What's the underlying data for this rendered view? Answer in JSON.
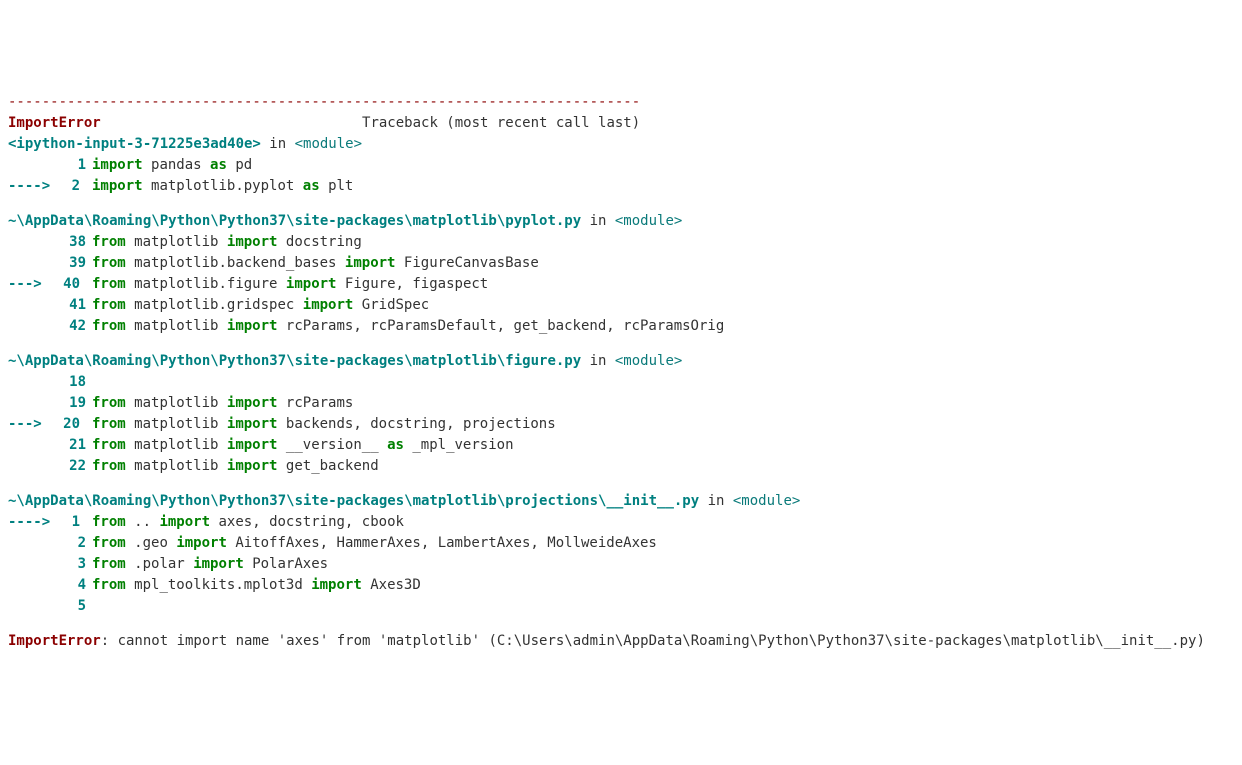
{
  "separator": "---------------------------------------------------------------------------",
  "error_name": "ImportError",
  "traceback_text": "Traceback (most recent call last)",
  "frames": [
    {
      "location_prefix": "<ipython-input-3-71225e3ad40e>",
      "location_suffix": " in ",
      "module_tag": "<module>",
      "lines": [
        {
          "arrow": "",
          "num": "1",
          "tokens": [
            [
              "kw",
              "import"
            ],
            [
              "sp",
              " "
            ],
            [
              "id",
              "pandas"
            ],
            [
              "sp",
              " "
            ],
            [
              "kw",
              "as"
            ],
            [
              "sp",
              " "
            ],
            [
              "id",
              "pd"
            ]
          ]
        },
        {
          "arrow": "----> ",
          "num": "2",
          "tokens": [
            [
              "kw",
              "import"
            ],
            [
              "sp",
              " "
            ],
            [
              "id",
              "matplotlib"
            ],
            [
              "punct",
              "."
            ],
            [
              "id",
              "pyplot"
            ],
            [
              "sp",
              " "
            ],
            [
              "kw",
              "as"
            ],
            [
              "sp",
              " "
            ],
            [
              "id",
              "plt"
            ]
          ]
        }
      ]
    },
    {
      "location_prefix": "~\\AppData\\Roaming\\Python\\Python37\\site-packages\\matplotlib\\pyplot.py",
      "location_suffix": " in ",
      "module_tag": "<module>",
      "lines": [
        {
          "arrow": "",
          "num": "38",
          "tokens": [
            [
              "kw",
              "from"
            ],
            [
              "sp",
              " "
            ],
            [
              "id",
              "matplotlib"
            ],
            [
              "sp",
              " "
            ],
            [
              "kw",
              "import"
            ],
            [
              "sp",
              " "
            ],
            [
              "id",
              "docstring"
            ]
          ]
        },
        {
          "arrow": "",
          "num": "39",
          "tokens": [
            [
              "kw",
              "from"
            ],
            [
              "sp",
              " "
            ],
            [
              "id",
              "matplotlib"
            ],
            [
              "punct",
              "."
            ],
            [
              "id",
              "backend_bases"
            ],
            [
              "sp",
              " "
            ],
            [
              "kw",
              "import"
            ],
            [
              "sp",
              " "
            ],
            [
              "id",
              "FigureCanvasBase"
            ]
          ]
        },
        {
          "arrow": "---> ",
          "num": "40",
          "tokens": [
            [
              "kw",
              "from"
            ],
            [
              "sp",
              " "
            ],
            [
              "id",
              "matplotlib"
            ],
            [
              "punct",
              "."
            ],
            [
              "id",
              "figure"
            ],
            [
              "sp",
              " "
            ],
            [
              "kw",
              "import"
            ],
            [
              "sp",
              " "
            ],
            [
              "id",
              "Figure"
            ],
            [
              "punct",
              ","
            ],
            [
              "sp",
              " "
            ],
            [
              "id",
              "figaspect"
            ]
          ]
        },
        {
          "arrow": "",
          "num": "41",
          "tokens": [
            [
              "kw",
              "from"
            ],
            [
              "sp",
              " "
            ],
            [
              "id",
              "matplotlib"
            ],
            [
              "punct",
              "."
            ],
            [
              "id",
              "gridspec"
            ],
            [
              "sp",
              " "
            ],
            [
              "kw",
              "import"
            ],
            [
              "sp",
              " "
            ],
            [
              "id",
              "GridSpec"
            ]
          ]
        },
        {
          "arrow": "",
          "num": "42",
          "tokens": [
            [
              "kw",
              "from"
            ],
            [
              "sp",
              " "
            ],
            [
              "id",
              "matplotlib"
            ],
            [
              "sp",
              " "
            ],
            [
              "kw",
              "import"
            ],
            [
              "sp",
              " "
            ],
            [
              "id",
              "rcParams"
            ],
            [
              "punct",
              ","
            ],
            [
              "sp",
              " "
            ],
            [
              "id",
              "rcParamsDefault"
            ],
            [
              "punct",
              ","
            ],
            [
              "sp",
              " "
            ],
            [
              "id",
              "get_backend"
            ],
            [
              "punct",
              ","
            ],
            [
              "sp",
              " "
            ],
            [
              "id",
              "rcParamsOrig"
            ]
          ]
        }
      ]
    },
    {
      "location_prefix": "~\\AppData\\Roaming\\Python\\Python37\\site-packages\\matplotlib\\figure.py",
      "location_suffix": " in ",
      "module_tag": "<module>",
      "lines": [
        {
          "arrow": "",
          "num": "18",
          "tokens": []
        },
        {
          "arrow": "",
          "num": "19",
          "tokens": [
            [
              "kw",
              "from"
            ],
            [
              "sp",
              " "
            ],
            [
              "id",
              "matplotlib"
            ],
            [
              "sp",
              " "
            ],
            [
              "kw",
              "import"
            ],
            [
              "sp",
              " "
            ],
            [
              "id",
              "rcParams"
            ]
          ]
        },
        {
          "arrow": "---> ",
          "num": "20",
          "tokens": [
            [
              "kw",
              "from"
            ],
            [
              "sp",
              " "
            ],
            [
              "id",
              "matplotlib"
            ],
            [
              "sp",
              " "
            ],
            [
              "kw",
              "import"
            ],
            [
              "sp",
              " "
            ],
            [
              "id",
              "backends"
            ],
            [
              "punct",
              ","
            ],
            [
              "sp",
              " "
            ],
            [
              "id",
              "docstring"
            ],
            [
              "punct",
              ","
            ],
            [
              "sp",
              " "
            ],
            [
              "id",
              "projections"
            ]
          ]
        },
        {
          "arrow": "",
          "num": "21",
          "tokens": [
            [
              "kw",
              "from"
            ],
            [
              "sp",
              " "
            ],
            [
              "id",
              "matplotlib"
            ],
            [
              "sp",
              " "
            ],
            [
              "kw",
              "import"
            ],
            [
              "sp",
              " "
            ],
            [
              "id",
              "__version__"
            ],
            [
              "sp",
              " "
            ],
            [
              "kw",
              "as"
            ],
            [
              "sp",
              " "
            ],
            [
              "id",
              "_mpl_version"
            ]
          ]
        },
        {
          "arrow": "",
          "num": "22",
          "tokens": [
            [
              "kw",
              "from"
            ],
            [
              "sp",
              " "
            ],
            [
              "id",
              "matplotlib"
            ],
            [
              "sp",
              " "
            ],
            [
              "kw",
              "import"
            ],
            [
              "sp",
              " "
            ],
            [
              "id",
              "get_backend"
            ]
          ]
        }
      ]
    },
    {
      "location_prefix": "~\\AppData\\Roaming\\Python\\Python37\\site-packages\\matplotlib\\projections\\__init__.py",
      "location_suffix": " in ",
      "module_tag": "<module>",
      "lines": [
        {
          "arrow": "----> ",
          "num": "1",
          "tokens": [
            [
              "kw",
              "from"
            ],
            [
              "sp",
              " "
            ],
            [
              "punct",
              ".."
            ],
            [
              "sp",
              " "
            ],
            [
              "kw",
              "import"
            ],
            [
              "sp",
              " "
            ],
            [
              "id",
              "axes"
            ],
            [
              "punct",
              ","
            ],
            [
              "sp",
              " "
            ],
            [
              "id",
              "docstring"
            ],
            [
              "punct",
              ","
            ],
            [
              "sp",
              " "
            ],
            [
              "id",
              "cbook"
            ]
          ]
        },
        {
          "arrow": "",
          "num": "2",
          "tokens": [
            [
              "kw",
              "from"
            ],
            [
              "sp",
              " "
            ],
            [
              "punct",
              "."
            ],
            [
              "id",
              "geo"
            ],
            [
              "sp",
              " "
            ],
            [
              "kw",
              "import"
            ],
            [
              "sp",
              " "
            ],
            [
              "id",
              "AitoffAxes"
            ],
            [
              "punct",
              ","
            ],
            [
              "sp",
              " "
            ],
            [
              "id",
              "HammerAxes"
            ],
            [
              "punct",
              ","
            ],
            [
              "sp",
              " "
            ],
            [
              "id",
              "LambertAxes"
            ],
            [
              "punct",
              ","
            ],
            [
              "sp",
              " "
            ],
            [
              "id",
              "MollweideAxes"
            ]
          ]
        },
        {
          "arrow": "",
          "num": "3",
          "tokens": [
            [
              "kw",
              "from"
            ],
            [
              "sp",
              " "
            ],
            [
              "punct",
              "."
            ],
            [
              "id",
              "polar"
            ],
            [
              "sp",
              " "
            ],
            [
              "kw",
              "import"
            ],
            [
              "sp",
              " "
            ],
            [
              "id",
              "PolarAxes"
            ]
          ]
        },
        {
          "arrow": "",
          "num": "4",
          "tokens": [
            [
              "kw",
              "from"
            ],
            [
              "sp",
              " "
            ],
            [
              "id",
              "mpl_toolkits"
            ],
            [
              "punct",
              "."
            ],
            [
              "id",
              "mplot3d"
            ],
            [
              "sp",
              " "
            ],
            [
              "kw",
              "import"
            ],
            [
              "sp",
              " "
            ],
            [
              "id",
              "Axes3D"
            ]
          ]
        },
        {
          "arrow": "",
          "num": "5",
          "tokens": []
        }
      ]
    }
  ],
  "final_error_name": "ImportError",
  "final_error_message": ": cannot import name 'axes' from 'matplotlib' (C:\\Users\\admin\\AppData\\Roaming\\Python\\Python37\\site-packages\\matplotlib\\__init__.py)"
}
